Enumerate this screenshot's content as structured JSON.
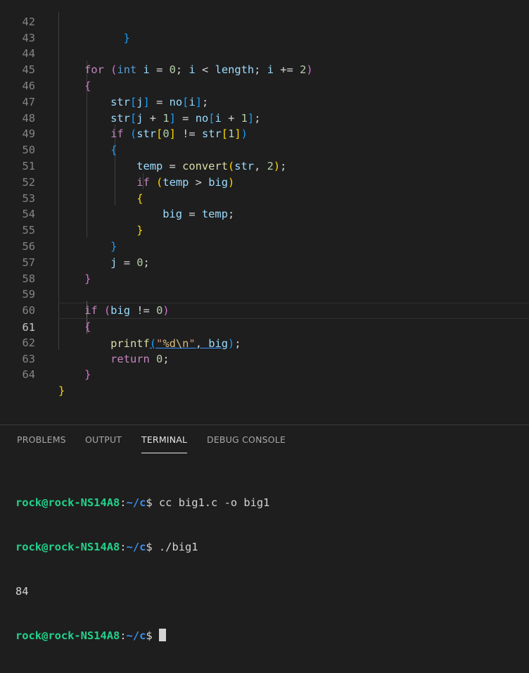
{
  "editor": {
    "line_numbers": [
      "42",
      "43",
      "44",
      "45",
      "46",
      "47",
      "48",
      "49",
      "50",
      "51",
      "52",
      "53",
      "54",
      "55",
      "56",
      "57",
      "58",
      "59",
      "60",
      "61",
      "62",
      "63",
      "64"
    ],
    "current_line": "61",
    "lines": {
      "l44": {
        "kw_for": "for",
        "paren_open": "(",
        "ty_int": "int",
        "v_i": "i",
        "eq": " = ",
        "n0": "0",
        "semi1": "; ",
        "v_i2": "i",
        "lt": " < ",
        "v_length": "length",
        "semi2": "; ",
        "v_i3": "i",
        "pe": " += ",
        "n2": "2",
        "paren_close": ")"
      },
      "l46": {
        "v_str": "str",
        "bo": "[",
        "v_j": "j",
        "bc": "]",
        "eq": " = ",
        "v_no": "no",
        "bo2": "[",
        "v_i": "i",
        "bc2": "]",
        "semi": ";"
      },
      "l47": {
        "v_str": "str",
        "bo": "[",
        "v_j": "j",
        "plus": " + ",
        "n1": "1",
        "bc": "]",
        "eq": " = ",
        "v_no": "no",
        "bo2": "[",
        "v_i": "i",
        "plus2": " + ",
        "n1b": "1",
        "bc2": "]",
        "semi": ";"
      },
      "l48": {
        "kw_if": "if",
        "po": " (",
        "v_str": "str",
        "bo": "[",
        "n0": "0",
        "bc": "]",
        "ne": " != ",
        "v_str2": "str",
        "bo2": "[",
        "n1": "1",
        "bc2": "]",
        "pc": ")"
      },
      "l50": {
        "v_temp": "temp",
        "eq": " = ",
        "f_convert": "convert",
        "po": "(",
        "v_str": "str",
        "comma": ", ",
        "n2": "2",
        "pc": ")",
        "semi": ";"
      },
      "l51": {
        "kw_if": "if",
        "po": " (",
        "v_temp": "temp",
        "gt": " > ",
        "v_big": "big",
        "pc": ")"
      },
      "l53": {
        "v_big": "big",
        "eq": " = ",
        "v_temp": "temp",
        "semi": ";"
      },
      "l56": {
        "v_j": "j",
        "eq": " = ",
        "n0": "0",
        "semi": ";"
      },
      "l59": {
        "kw_if": "if",
        "po": " (",
        "v_big": "big",
        "ne": " != ",
        "n0": "0",
        "pc": ")"
      },
      "l61": {
        "f_printf": "printf",
        "po": "(",
        "s_open": "\"",
        "s_fmt": "%d",
        "s_esc": "\\n",
        "s_close": "\"",
        "comma": ", ",
        "v_big": "big",
        "pc": ")",
        "semi": ";"
      },
      "l62": {
        "kw_return": "return",
        "sp": " ",
        "n0": "0",
        "semi": ";"
      }
    },
    "braces": {
      "open": "{",
      "close": "}"
    }
  },
  "panel": {
    "tabs": [
      "PROBLEMS",
      "OUTPUT",
      "TERMINAL",
      "DEBUG CONSOLE"
    ],
    "active_tab": "TERMINAL",
    "terminal": {
      "lines": [
        {
          "user": "rock@rock-NS14A8",
          "colon": ":",
          "path": "~/c",
          "prompt": "$ ",
          "cmd": "cc big1.c -o big1"
        },
        {
          "user": "rock@rock-NS14A8",
          "colon": ":",
          "path": "~/c",
          "prompt": "$ ",
          "cmd": "./big1"
        },
        {
          "output": "84"
        },
        {
          "user": "rock@rock-NS14A8",
          "colon": ":",
          "path": "~/c",
          "prompt": "$ ",
          "cmd": ""
        }
      ]
    }
  },
  "colors": {
    "background": "#1e1e1e",
    "keyword": "#c586c0",
    "type": "#569cd6",
    "variable": "#9cdcfe",
    "function": "#dcdcaa",
    "number": "#b5cea8",
    "string": "#ce9178",
    "prompt_user": "#23d18b",
    "prompt_path": "#3b8eea"
  }
}
